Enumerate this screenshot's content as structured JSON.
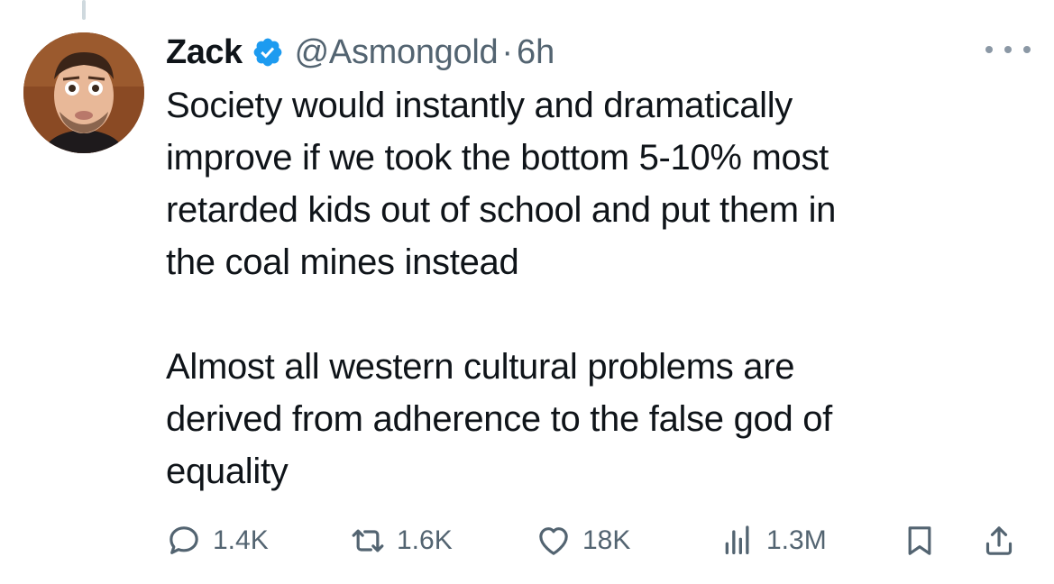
{
  "tweet": {
    "display_name": "Zack",
    "handle": "@Asmongold",
    "separator": "·",
    "time": "6h",
    "paragraphs": [
      "Society would instantly and dramatically\nimprove if we took the bottom 5-10% most\nretarded kids out of school and put them in\nthe coal mines instead",
      "Almost all western cultural problems are\nderived from adherence to the false god of\nequality"
    ]
  },
  "actions": {
    "replies": "1.4K",
    "reposts": "1.6K",
    "likes": "18K",
    "views": "1.3M"
  },
  "icons": {
    "verified": "verified-badge-icon",
    "more": "more-options-icon",
    "reply": "reply-icon",
    "repost": "repost-icon",
    "like": "heart-icon",
    "views": "analytics-icon",
    "bookmark": "bookmark-icon",
    "share": "share-icon"
  },
  "colors": {
    "text": "#0f1419",
    "secondary": "#536471",
    "verified": "#1d9bf0",
    "thread_line": "#cfd9de"
  }
}
